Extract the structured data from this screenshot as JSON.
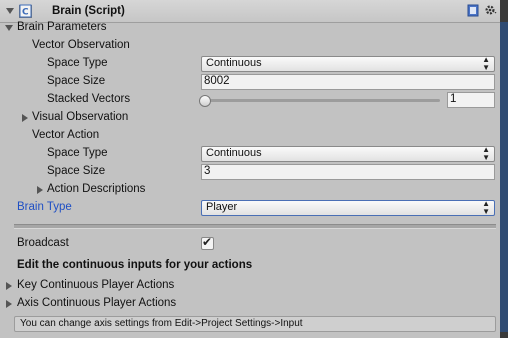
{
  "header": {
    "title": "Brain (Script)",
    "script_icon": "script-icon",
    "help_icon": "book-icon",
    "settings_icon": "gear-icon",
    "enabled": true
  },
  "brain_parameters": {
    "label": "Brain Parameters",
    "vector_observation": {
      "label": "Vector Observation",
      "space_type_label": "Space Type",
      "space_type_value": "Continuous",
      "space_size_label": "Space Size",
      "space_size_value": "8002",
      "stacked_vectors_label": "Stacked Vectors",
      "stacked_vectors_value": "1"
    },
    "visual_observation": {
      "label": "Visual Observation"
    },
    "vector_action": {
      "label": "Vector Action",
      "space_type_label": "Space Type",
      "space_type_value": "Continuous",
      "space_size_label": "Space Size",
      "space_size_value": "3",
      "action_descriptions_label": "Action Descriptions"
    }
  },
  "brain_type": {
    "label": "Brain Type",
    "value": "Player",
    "accent": "#1f4fc4"
  },
  "broadcast": {
    "label": "Broadcast",
    "checked": true,
    "mark": "✔"
  },
  "section": {
    "heading": "Edit the continuous inputs for your actions",
    "key_actions": "Key Continuous Player Actions",
    "axis_actions": "Axis Continuous Player Actions",
    "help_text": "You can change axis settings from Edit->Project Settings->Input"
  }
}
